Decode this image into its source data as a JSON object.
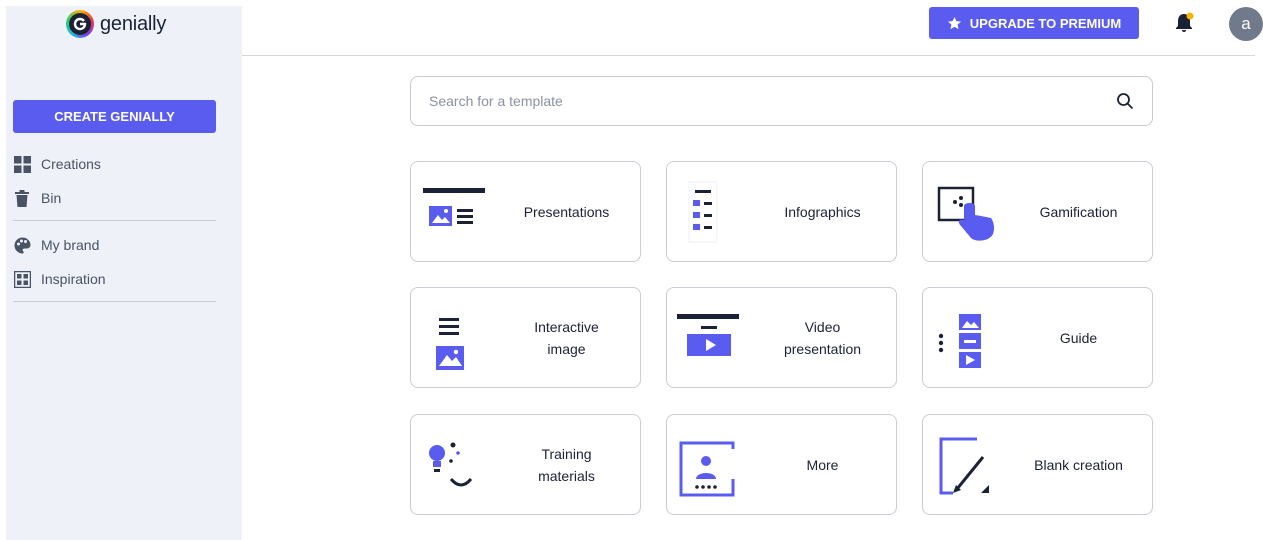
{
  "brand": {
    "name": "genially"
  },
  "sidebar": {
    "create_label": "CREATE GENIALLY",
    "items": [
      {
        "label": "Creations",
        "icon": "grid-icon"
      },
      {
        "label": "Bin",
        "icon": "trash-icon"
      },
      {
        "label": "My brand",
        "icon": "palette-icon"
      },
      {
        "label": "Inspiration",
        "icon": "gallery-icon"
      }
    ]
  },
  "header": {
    "upgrade_label": "UPGRADE TO PREMIUM",
    "avatar_initial": "a"
  },
  "search": {
    "placeholder": "Search for a template",
    "value": ""
  },
  "templates": [
    {
      "label": "Presentations",
      "icon": "presentation-icon"
    },
    {
      "label": "Infographics",
      "icon": "infographic-icon"
    },
    {
      "label": "Gamification",
      "icon": "gamification-icon"
    },
    {
      "label": "Interactive\nimage",
      "icon": "interactive-image-icon"
    },
    {
      "label": "Video\npresentation",
      "icon": "video-presentation-icon"
    },
    {
      "label": "Guide",
      "icon": "guide-icon"
    },
    {
      "label": "Training\nmaterials",
      "icon": "training-icon"
    },
    {
      "label": "More",
      "icon": "more-icon"
    },
    {
      "label": "Blank creation",
      "icon": "blank-creation-icon"
    }
  ],
  "colors": {
    "accent": "#5a5cf0",
    "dark": "#1b2235",
    "sidebar_bg": "#eef1f7",
    "notify_dot": "#f5b400"
  }
}
